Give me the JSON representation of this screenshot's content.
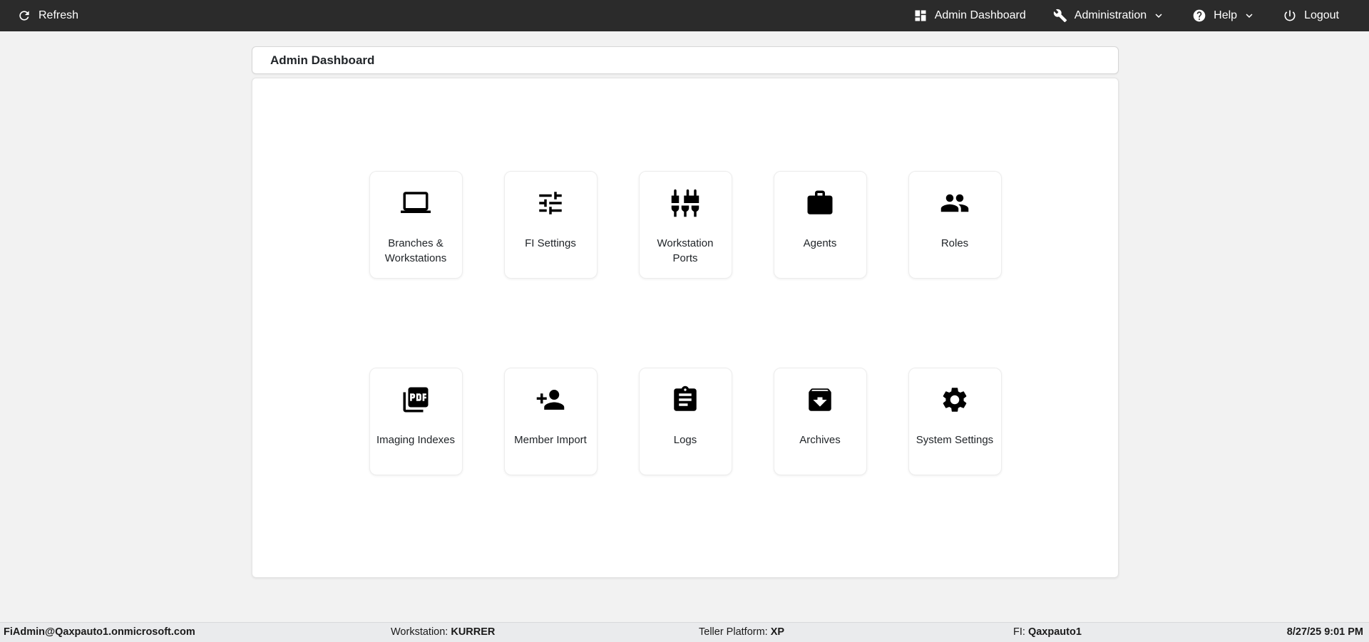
{
  "navbar": {
    "refresh_label": "Refresh",
    "items": [
      {
        "label": "Admin Dashboard",
        "icon": "dashboard-icon",
        "has_caret": false
      },
      {
        "label": "Administration",
        "icon": "wrench-icon",
        "has_caret": true
      },
      {
        "label": "Help",
        "icon": "help-icon",
        "has_caret": true
      },
      {
        "label": "Logout",
        "icon": "power-icon",
        "has_caret": false
      }
    ]
  },
  "page": {
    "title": "Admin Dashboard"
  },
  "tiles": [
    {
      "label": "Branches & Workstations",
      "icon": "laptop-icon"
    },
    {
      "label": "FI Settings",
      "icon": "tune-icon"
    },
    {
      "label": "Workstation Ports",
      "icon": "ports-icon"
    },
    {
      "label": "Agents",
      "icon": "briefcase-icon"
    },
    {
      "label": "Roles",
      "icon": "people-icon"
    },
    {
      "label": "Imaging Indexes",
      "icon": "pdf-icon"
    },
    {
      "label": "Member Import",
      "icon": "person-add-icon"
    },
    {
      "label": "Logs",
      "icon": "clipboard-icon"
    },
    {
      "label": "Archives",
      "icon": "archive-icon"
    },
    {
      "label": "System Settings",
      "icon": "gear-icon"
    }
  ],
  "statusbar": {
    "user": "FiAdmin@Qaxpauto1.onmicrosoft.com",
    "workstation_label": "Workstation:",
    "workstation_value": "KURRER",
    "teller_platform_label": "Teller Platform:",
    "teller_platform_value": "XP",
    "fi_label": "FI:",
    "fi_value": "Qaxpauto1",
    "datetime": "8/27/25 9:01 PM"
  },
  "colors": {
    "navbar_bg": "#2b2b2b",
    "page_bg": "#f2f2f2",
    "card_bg": "#ffffff",
    "statusbar_bg": "#eaebed",
    "text_dark": "#212529",
    "icon_black": "#000000"
  }
}
